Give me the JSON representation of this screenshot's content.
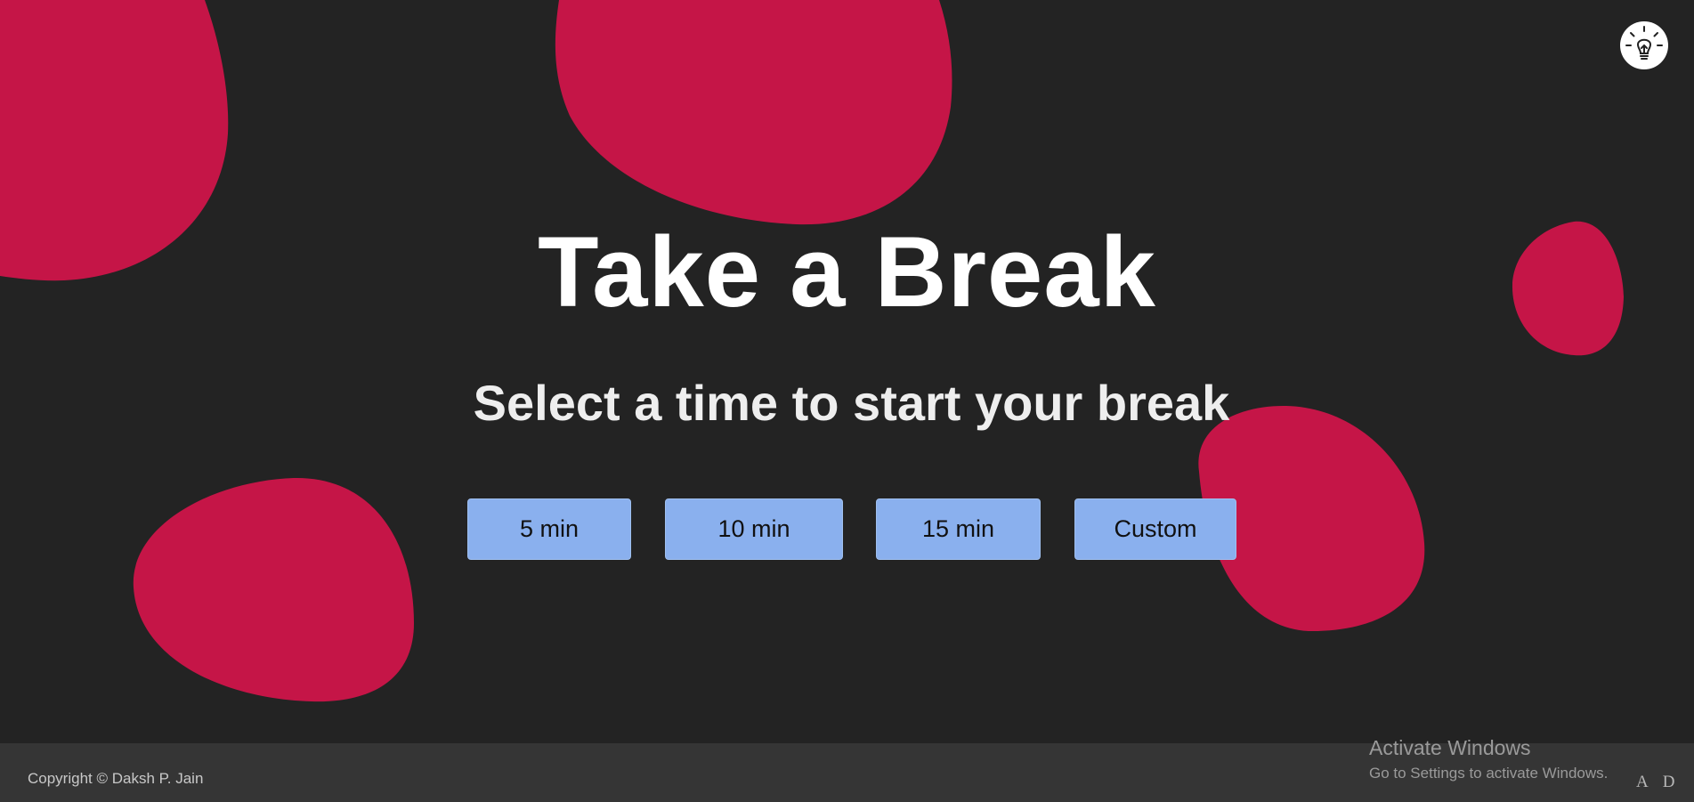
{
  "colors": {
    "background": "#232323",
    "blob": "#c51547",
    "button": "#8ab0ee",
    "footer": "#353535"
  },
  "header": {
    "theme_toggle_icon": "lightbulb-icon"
  },
  "main": {
    "title": "Take a Break",
    "subtitle": "Select a time to start your break",
    "buttons": [
      {
        "label": "5 min"
      },
      {
        "label": "10 min"
      },
      {
        "label": "15 min"
      },
      {
        "label": "Custom"
      }
    ]
  },
  "footer": {
    "copyright": "Copyright © Daksh P. Jain"
  },
  "os_overlay": {
    "activate_title": "Activate Windows",
    "activate_subtitle": "Go to Settings to activate Windows.",
    "letter_a": "A",
    "letter_d": "D"
  }
}
